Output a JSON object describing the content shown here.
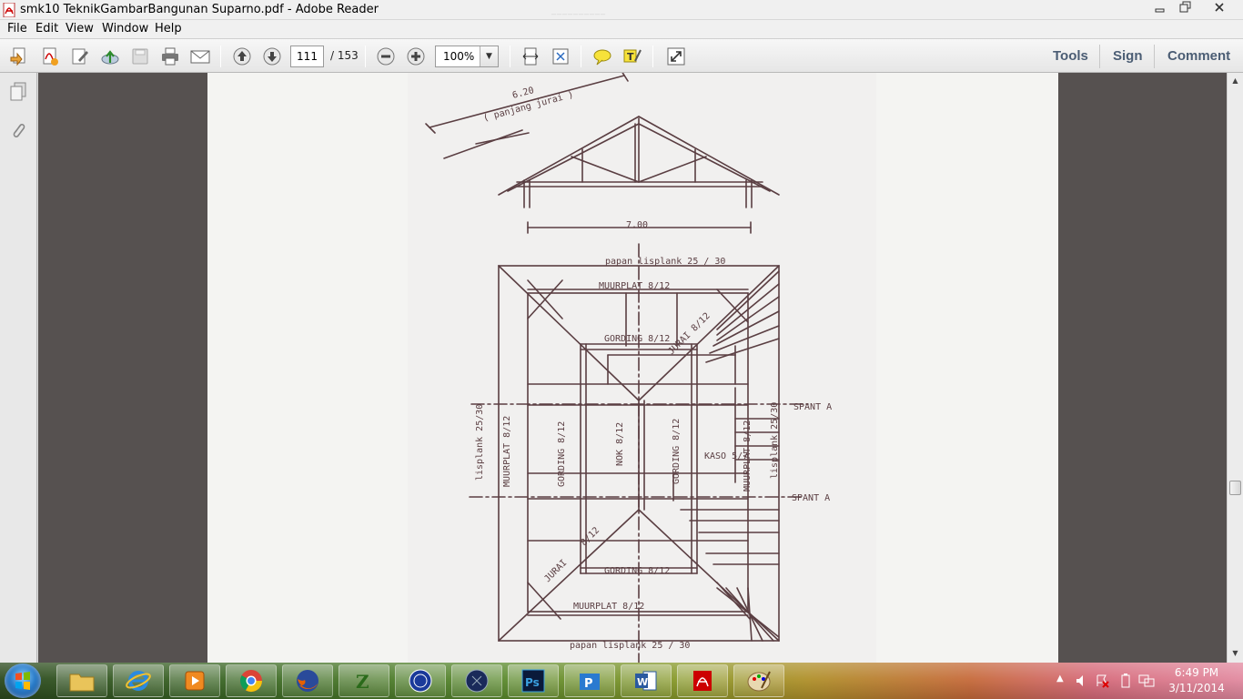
{
  "window": {
    "title": "smk10 TeknikGambarBangunan Suparno.pdf - Adobe Reader",
    "ghost_text": "__________"
  },
  "menu": {
    "items": [
      "File",
      "Edit",
      "View",
      "Window",
      "Help"
    ]
  },
  "toolbar": {
    "current_page": "111",
    "total_pages": "/ 153",
    "zoom": "100%",
    "tools_label": "Tools",
    "sign_label": "Sign",
    "comment_label": "Comment"
  },
  "drawing": {
    "labels": {
      "panjang_dim": "6.20",
      "panjang_text": "( panjang  jurai )",
      "width_dim": "7.00",
      "lisplank_top": "papan  lisplank 25 / 30",
      "muurplat_top": "MUURPLAT  8/12",
      "gording_top": "GORDING 8/12",
      "jurai_tr": "JURAI  8/12",
      "spant_1": "SPANT   A",
      "spant_2": "SPANT  A",
      "lisplank_left": "lisplank  25/30",
      "muurplat_left": "MUURPLAT  8/12",
      "gording_left": "GORDING 8/12",
      "nok": "NOK  8/12",
      "gording_right": "GORDING 8/12",
      "kaso": "KASO 5/7",
      "muurplat_right": "MUURPLAT 8/12",
      "lisplank_right": "lisplank 25/30",
      "jurai_bl_a": "8/12",
      "jurai_bl_b": "JURAI",
      "gording_bottom": "GORDING 8/12",
      "muurplat_bottom": "MUURPLAT    8/12",
      "lisplank_bottom": "papan  lisplank 25 / 30"
    }
  },
  "clock": {
    "time": "6:49 PM",
    "date": "3/11/2014"
  },
  "colors": {
    "doc_bg": "#565150",
    "ink": "#5a3e42",
    "accent_link": "#4b5d74"
  }
}
